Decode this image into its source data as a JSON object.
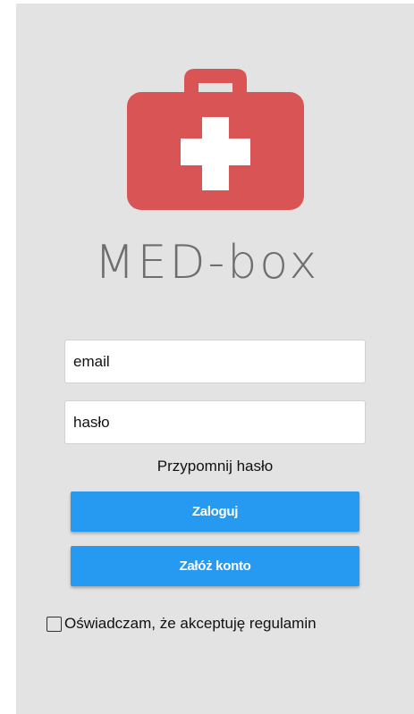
{
  "app": {
    "logo_text": "MED-box",
    "logo_icon": "medical-kit-icon",
    "brand_color": "#d95454"
  },
  "login_form": {
    "email_placeholder": "email",
    "password_placeholder": "hasło",
    "forgot_password_label": "Przypomnij hasło",
    "login_button_label": "Zaloguj",
    "register_button_label": "Załóż konto",
    "terms_label": "Oświadczam, że akceptuję regulamin",
    "terms_checked": false,
    "button_color": "#2699f0"
  }
}
